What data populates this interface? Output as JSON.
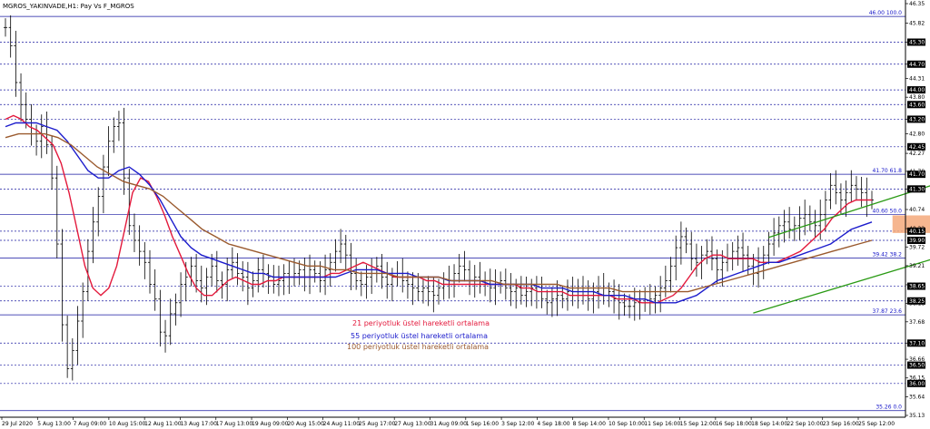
{
  "header": {
    "title": "MGROS_YAKINVADE,H1: Pay Vs F_MGROS"
  },
  "colors": {
    "background": "#ffffff",
    "axis": "#000000",
    "candle": "#000000",
    "dotted_level": "#1a1aa0",
    "solid_level": "#1414a0",
    "ema21": "#e3193c",
    "ema55": "#1c1ccc",
    "ema100": "#9a5a2e",
    "channel": "#2a9a14",
    "zone": "#f4a97b",
    "fib_label": "#1414c8",
    "axis_label_box": "#000000"
  },
  "legend": [
    {
      "text": "21 periyotluk üstel hareketli ortalama",
      "color": "#e3193c"
    },
    {
      "text": "55 periyotluk üstel hareketli ortalama",
      "color": "#1c1ccc"
    },
    {
      "text": "100 periyotluk üstel hareketli ortalama",
      "color": "#9a5a2e"
    }
  ],
  "chart_data": {
    "type": "line",
    "title": "MGROS_YAKINVADE,H1: Pay Vs F_MGROS",
    "ylim": [
      35.13,
      46.35
    ],
    "y_axis_ticks": [
      "46.35",
      "45.82",
      "45.30",
      "44.70",
      "44.31",
      "43.80",
      "43.20",
      "42.80",
      "42.27",
      "41.78",
      "41.30",
      "40.74",
      "40.22",
      "39.72",
      "39.21",
      "38.69",
      "38.18",
      "37.68",
      "37.10",
      "36.66",
      "36.15",
      "35.64",
      "35.13"
    ],
    "y_axis_highlight": [
      "45.30",
      "44.70",
      "44.00",
      "43.60",
      "43.20",
      "42.45",
      "41.70",
      "41.30",
      "40.15",
      "39.90",
      "38.65",
      "38.25",
      "37.10",
      "36.50",
      "36.00"
    ],
    "x_axis_ticks": [
      "29 Jul 2020",
      "5 Aug 13:00",
      "7 Aug 09:00",
      "10 Aug 15:00",
      "12 Aug 11:00",
      "13 Aug 17:00",
      "17 Aug 13:00",
      "19 Aug 09:00",
      "20 Aug 15:00",
      "24 Aug 11:00",
      "25 Aug 17:00",
      "27 Aug 13:00",
      "31 Aug 09:00",
      "1 Sep 16:00",
      "3 Sep 12:00",
      "4 Sep 18:00",
      "8 Sep 14:00",
      "10 Sep 10:00",
      "11 Sep 16:00",
      "15 Sep 12:00",
      "16 Sep 18:00",
      "18 Sep 14:00",
      "22 Sep 10:00",
      "23 Sep 16:00",
      "25 Sep 12:00"
    ],
    "horizontal_levels": {
      "dotted": [
        45.3,
        44.7,
        44.0,
        43.6,
        43.2,
        42.45,
        41.3,
        40.15,
        39.9,
        38.65,
        38.25,
        37.1,
        36.5,
        36.0
      ],
      "solid": [
        46.0,
        41.7,
        40.6,
        39.42,
        37.87,
        35.26
      ]
    },
    "fib_labels": [
      {
        "text": "46.00 100.0",
        "price": 46.0
      },
      {
        "text": "41.70 61.8",
        "price": 41.7
      },
      {
        "text": "40.60 50.0",
        "price": 40.6
      },
      {
        "text": "39.42 38.2",
        "price": 39.42
      },
      {
        "text": "37.87 23.6",
        "price": 37.87
      },
      {
        "text": "35.26 0.0",
        "price": 35.26
      }
    ],
    "channel": {
      "upper": [
        [
          148,
          39.98
        ],
        [
          193,
          42.0
        ]
      ],
      "lower": [
        [
          145,
          37.92
        ],
        [
          193,
          39.95
        ]
      ]
    },
    "zone": {
      "x0": 172,
      "x1": 194,
      "y0": 40.1,
      "y1": 40.58
    },
    "series": [
      {
        "name": "Pay Vs F_MGROS",
        "values": [
          45.7,
          45.2,
          44.2,
          43.6,
          43.2,
          42.8,
          42.6,
          43.0,
          42.5,
          41.6,
          39.8,
          37.6,
          36.4,
          36.9,
          37.7,
          38.5,
          39.6,
          40.4,
          41.1,
          41.9,
          42.6,
          43.0,
          43.1,
          41.6,
          40.3,
          39.9,
          39.6,
          39.3,
          38.7,
          38.3,
          37.4,
          37.3,
          37.9,
          38.2,
          38.7,
          38.9,
          39.2,
          38.8,
          38.6,
          38.9,
          39.2,
          38.8,
          38.7,
          39.1,
          39.3,
          39.0,
          38.9,
          38.6,
          38.8,
          39.1,
          39.0,
          38.9,
          38.7,
          38.8,
          39.0,
          38.9,
          39.0,
          39.1,
          38.9,
          39.1,
          39.0,
          38.8,
          39.1,
          39.3,
          39.6,
          39.8,
          39.5,
          39.0,
          38.8,
          38.7,
          38.9,
          39.0,
          39.2,
          38.9,
          38.7,
          38.9,
          39.0,
          38.8,
          38.7,
          38.6,
          38.5,
          38.6,
          38.5,
          38.4,
          38.6,
          38.7,
          38.8,
          39.0,
          39.2,
          39.1,
          38.8,
          38.9,
          38.7,
          38.8,
          38.6,
          38.7,
          38.8,
          38.6,
          38.5,
          38.6,
          38.4,
          38.5,
          38.6,
          38.5,
          38.3,
          38.2,
          38.3,
          38.4,
          38.3,
          38.5,
          38.5,
          38.6,
          38.4,
          38.3,
          38.5,
          38.6,
          38.4,
          38.5,
          38.3,
          38.2,
          38.1,
          38.1,
          38.2,
          38.3,
          38.2,
          38.3,
          38.4,
          38.6,
          38.8,
          39.2,
          39.7,
          40.0,
          39.8,
          39.4,
          39.3,
          39.5,
          39.6,
          39.4,
          39.1,
          39.3,
          39.4,
          39.6,
          39.7,
          39.5,
          39.2,
          39.0,
          39.3,
          39.5,
          39.8,
          40.1,
          40.3,
          40.4,
          40.2,
          40.3,
          40.5,
          40.6,
          40.4,
          40.3,
          40.6,
          41.0,
          41.4,
          41.2,
          41.0,
          41.2,
          41.4,
          41.3,
          41.2,
          41.0,
          41.0
        ]
      },
      {
        "name": "21 periyotluk üstel hareketli ortalama",
        "values": [
          43.2,
          43.3,
          43.2,
          43.0,
          42.9,
          42.7,
          42.5,
          42.0,
          41.2,
          40.2,
          39.2,
          38.6,
          38.4,
          38.6,
          39.2,
          40.2,
          41.2,
          41.6,
          41.5,
          41.1,
          40.6,
          40.0,
          39.5,
          39.0,
          38.6,
          38.4,
          38.4,
          38.6,
          38.8,
          38.9,
          38.8,
          38.7,
          38.7,
          38.8,
          38.8,
          38.9,
          38.9,
          38.9,
          38.9,
          38.9,
          38.9,
          39.0,
          39.0,
          39.1,
          39.2,
          39.3,
          39.2,
          39.1,
          39.0,
          38.9,
          38.9,
          38.9,
          38.9,
          38.8,
          38.8,
          38.7,
          38.7,
          38.7,
          38.7,
          38.7,
          38.7,
          38.7,
          38.7,
          38.7,
          38.7,
          38.6,
          38.6,
          38.5,
          38.5,
          38.5,
          38.5,
          38.4,
          38.4,
          38.4,
          38.4,
          38.4,
          38.4,
          38.3,
          38.3,
          38.3,
          38.2,
          38.2,
          38.2,
          38.3,
          38.4,
          38.6,
          38.9,
          39.2,
          39.4,
          39.5,
          39.5,
          39.4,
          39.4,
          39.4,
          39.4,
          39.3,
          39.3,
          39.3,
          39.4,
          39.5,
          39.6,
          39.8,
          40.0,
          40.2,
          40.5,
          40.7,
          40.9,
          41.0,
          41.0,
          41.0
        ]
      },
      {
        "name": "55 periyotluk üstel hareketli ortalama",
        "values": [
          43.0,
          43.1,
          43.1,
          43.1,
          43.0,
          42.9,
          42.6,
          42.2,
          41.8,
          41.6,
          41.6,
          41.8,
          41.9,
          41.7,
          41.4,
          41.0,
          40.5,
          40.0,
          39.7,
          39.5,
          39.4,
          39.3,
          39.2,
          39.1,
          39.0,
          39.0,
          38.9,
          38.9,
          38.9,
          38.9,
          38.9,
          38.9,
          38.9,
          39.0,
          39.1,
          39.1,
          39.1,
          39.0,
          39.0,
          39.0,
          38.9,
          38.9,
          38.9,
          38.8,
          38.8,
          38.8,
          38.8,
          38.7,
          38.7,
          38.7,
          38.7,
          38.7,
          38.6,
          38.6,
          38.6,
          38.5,
          38.5,
          38.5,
          38.4,
          38.4,
          38.4,
          38.3,
          38.3,
          38.2,
          38.2,
          38.2,
          38.3,
          38.4,
          38.6,
          38.8,
          38.9,
          39.0,
          39.1,
          39.2,
          39.3,
          39.3,
          39.4,
          39.5,
          39.6,
          39.7,
          39.8,
          40.0,
          40.2,
          40.3,
          40.4
        ]
      },
      {
        "name": "100 periyotluk üstel hareketli ortalama",
        "values": [
          42.7,
          42.8,
          42.8,
          42.8,
          42.7,
          42.5,
          42.2,
          41.9,
          41.7,
          41.5,
          41.4,
          41.3,
          41.1,
          40.8,
          40.5,
          40.2,
          40.0,
          39.8,
          39.7,
          39.6,
          39.5,
          39.4,
          39.3,
          39.2,
          39.2,
          39.1,
          39.1,
          39.0,
          39.0,
          39.0,
          38.9,
          38.9,
          38.9,
          38.9,
          38.8,
          38.8,
          38.8,
          38.8,
          38.7,
          38.7,
          38.7,
          38.7,
          38.7,
          38.6,
          38.6,
          38.6,
          38.6,
          38.5,
          38.5,
          38.5,
          38.5,
          38.5,
          38.5,
          38.6,
          38.7,
          38.8,
          38.9,
          39.0,
          39.1,
          39.2,
          39.3,
          39.4,
          39.5,
          39.6,
          39.7,
          39.8,
          39.9
        ]
      }
    ]
  }
}
